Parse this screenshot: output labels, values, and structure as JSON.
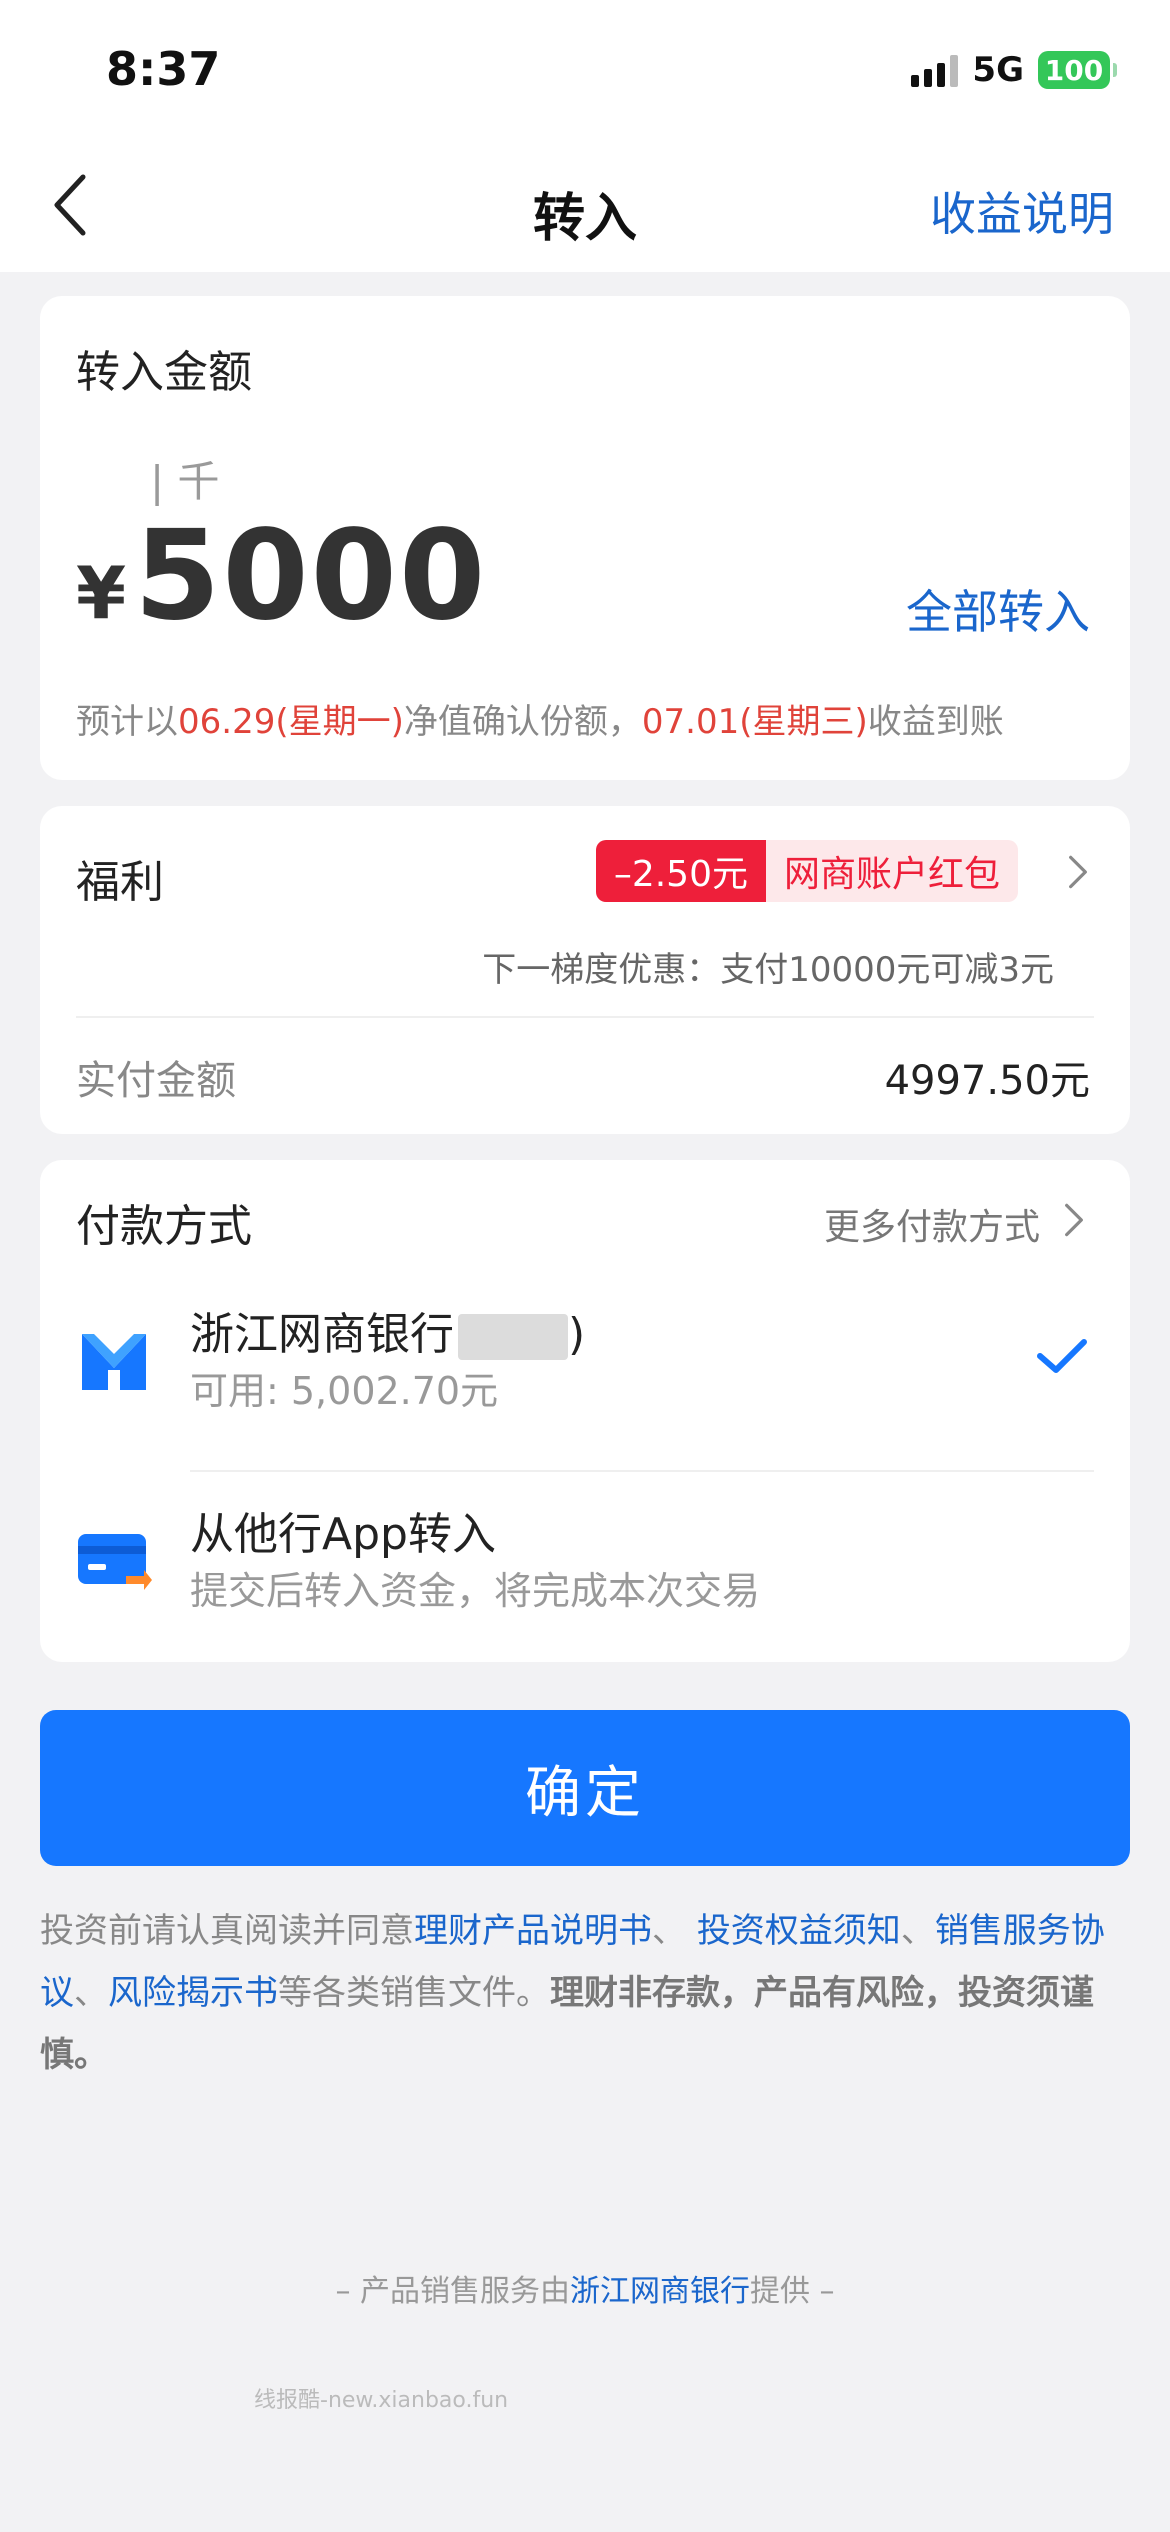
{
  "status_bar": {
    "time": "8:37",
    "network": "5G",
    "battery": "100"
  },
  "nav": {
    "title": "转入",
    "right_link": "收益说明"
  },
  "amount_card": {
    "label": "转入金额",
    "unit_hint": "| 千",
    "currency": "¥",
    "value": "5000",
    "all_in": "全部转入",
    "estimate": {
      "p1": "预计以",
      "date1": "06.29(星期一)",
      "p2": "净值确认份额，",
      "date2": "07.01(星期三)",
      "p3": "收益到账"
    }
  },
  "benefit_card": {
    "label": "福利",
    "discount_amount": "–2.50元",
    "discount_name": "网商账户红包",
    "next_tier": "下一梯度优惠：支付10000元可减3元",
    "paid_label": "实付金额",
    "paid_value": "4997.50元"
  },
  "payment_card": {
    "title": "付款方式",
    "more": "更多付款方式",
    "methods": [
      {
        "name": "浙江网商银行",
        "suffix": ")",
        "sub": "可用: 5,002.70元",
        "icon": "mybank-logo-icon",
        "selected": true
      },
      {
        "name": "从他行App转入",
        "sub": "提交后转入资金，将完成本次交易",
        "icon": "bank-card-transfer-icon",
        "selected": false
      }
    ]
  },
  "confirm_label": "确定",
  "agreement": {
    "p1": "投资前请认真阅读并同意",
    "link1": "理财产品说明书",
    "sep1": "、 ",
    "link2": "投资权益须知",
    "sep2": "、",
    "link3": "销售服务协议",
    "sep3": "、",
    "link4": "风险揭示书",
    "p2": "等各类销售文件。",
    "bold": "理财非存款，产品有风险，投资须谨慎。"
  },
  "footer": {
    "p1": "– 产品销售服务由",
    "link": "浙江网商银行",
    "p2": "提供 –"
  },
  "watermark": "线报酷-new.xianbao.fun",
  "colors": {
    "accent": "#1677ff",
    "link": "#1a66cc",
    "red": "#e0433a",
    "badge_red": "#ee1f3a"
  }
}
